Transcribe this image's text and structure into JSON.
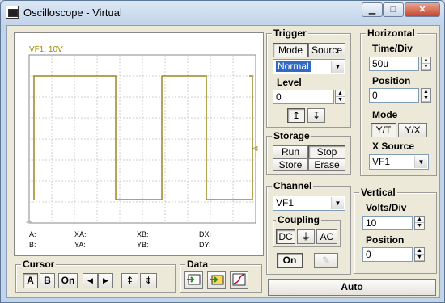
{
  "window": {
    "title": "Oscilloscope - Virtual",
    "minimize": "▁",
    "maximize": "□",
    "close": "✕"
  },
  "display": {
    "channel_label": "VF1: 10V",
    "readouts": {
      "a": "A:",
      "b": "B:",
      "xa": "XA:",
      "ya": "YA:",
      "xb": "XB:",
      "yb": "YB:",
      "dx": "DX:",
      "dy": "DY:"
    },
    "trace_color": "#9a8a1a",
    "trigger_marker": "⊲"
  },
  "trigger": {
    "title": "Trigger",
    "mode_label": "Mode",
    "source_label": "Source",
    "mode_value": "Normal",
    "level_label": "Level",
    "level_value": "0",
    "rising_edge": "↥",
    "falling_edge": "↧"
  },
  "horizontal": {
    "title": "Horizontal",
    "time_div_label": "Time/Div",
    "time_div_value": "50u",
    "position_label": "Position",
    "position_value": "0",
    "mode_label": "Mode",
    "mode_yt": "Y/T",
    "mode_yx": "Y/X",
    "xsource_label": "X Source",
    "xsource_value": "VF1"
  },
  "storage": {
    "title": "Storage",
    "run": "Run",
    "stop": "Stop",
    "store": "Store",
    "erase": "Erase"
  },
  "channel": {
    "title": "Channel",
    "value": "VF1",
    "coupling_title": "Coupling",
    "dc": "DC",
    "gnd": "⏚",
    "ac": "AC",
    "on": "On"
  },
  "vertical": {
    "title": "Vertical",
    "volts_div_label": "Volts/Div",
    "volts_div_value": "10",
    "position_label": "Position",
    "position_value": "0"
  },
  "cursor": {
    "title": "Cursor",
    "a": "A",
    "b": "B",
    "on": "On",
    "left": "◀",
    "right": "▶",
    "up": "⇞",
    "down": "⇟"
  },
  "data": {
    "title": "Data"
  },
  "auto_label": "Auto"
}
